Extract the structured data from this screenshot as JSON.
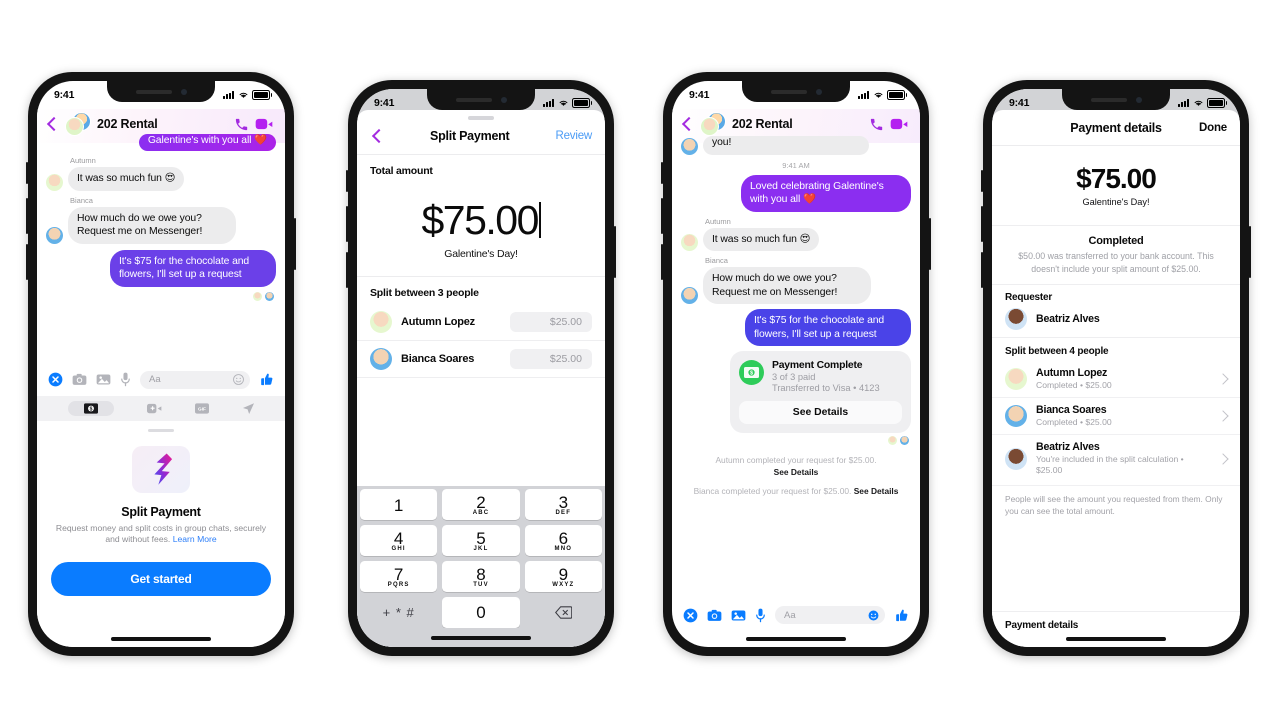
{
  "phones": {
    "p1": {
      "status": {
        "time": "9:41"
      },
      "header": {
        "title": "202 Rental",
        "back_icon": "back-chevron-icon",
        "call_icon": "phone-call-icon",
        "video_icon": "video-camera-icon"
      },
      "messages": [
        {
          "id": "m0",
          "side": "out",
          "text": "Galentine's with you all ❤️",
          "clipped": true
        },
        {
          "id": "m1",
          "side": "in",
          "sender": "Autumn",
          "text": "It was so much fun 😍"
        },
        {
          "id": "m2",
          "side": "in",
          "sender": "Bianca",
          "text": "How much do we owe you? Request me on Messenger!"
        },
        {
          "id": "m3",
          "side": "out",
          "text": "It's $75 for the chocolate and flowers, I'll set up a request"
        }
      ],
      "composer": {
        "placeholder": "Aa",
        "icons": [
          "close-icon",
          "camera-icon",
          "gallery-icon",
          "microphone-icon",
          "emoji-icon",
          "thumbs-up-icon"
        ]
      },
      "tabrow": [
        "payments-icon",
        "video-add-icon",
        "gif-icon",
        "location-icon"
      ],
      "sheet": {
        "icon": "split-payment-dollar-icon",
        "title": "Split Payment",
        "description": "Request money and split costs in group chats, securely and without fees.",
        "link": "Learn More",
        "cta": "Get started"
      }
    },
    "p2": {
      "status": {
        "time": "9:41"
      },
      "nav": {
        "back_icon": "back-chevron-icon",
        "title": "Split Payment",
        "action": "Review"
      },
      "total_label": "Total amount",
      "amount": "$75.00",
      "memo": "Galentine's Day!",
      "split_label": "Split between 3 people",
      "people": [
        {
          "name": "Autumn Lopez",
          "amount": "$25.00"
        },
        {
          "name": "Bianca Soares",
          "amount": "$25.00"
        }
      ],
      "keypad": [
        {
          "d": "1",
          "s": ""
        },
        {
          "d": "2",
          "s": "ABC"
        },
        {
          "d": "3",
          "s": "DEF"
        },
        {
          "d": "4",
          "s": "GHI"
        },
        {
          "d": "5",
          "s": "JKL"
        },
        {
          "d": "6",
          "s": "MNO"
        },
        {
          "d": "7",
          "s": "PQRS"
        },
        {
          "d": "8",
          "s": "TUV"
        },
        {
          "d": "9",
          "s": "WXYZ"
        }
      ],
      "key_symbols": "+ * #",
      "key_zero": "0",
      "key_delete": "backspace-icon"
    },
    "p3": {
      "status": {
        "time": "9:41"
      },
      "header": {
        "title": "202 Rental",
        "back_icon": "back-chevron-icon",
        "call_icon": "phone-call-icon",
        "video_icon": "video-camera-icon"
      },
      "clipped_top": "you!",
      "timestamp": "9:41 AM",
      "messages": [
        {
          "id": "m1",
          "side": "out",
          "text": "Loved celebrating Galentine's with you all ❤️"
        },
        {
          "id": "m2",
          "side": "in",
          "sender": "Autumn",
          "text": "It was so much fun 😍"
        },
        {
          "id": "m3",
          "side": "in",
          "sender": "Bianca",
          "text": "How much do we owe you? Request me on Messenger!"
        },
        {
          "id": "m4",
          "side": "out",
          "text": "It's $75 for the chocolate and flowers, I'll set up a request"
        }
      ],
      "paycard": {
        "badge_icon": "money-bill-icon",
        "title": "Payment Complete",
        "line1": "3 of 3 paid",
        "line2": "Transferred to Visa • 4123",
        "button": "See Details"
      },
      "syslogs": [
        {
          "text": "Autumn completed your request for $25.00.",
          "link": "See Details",
          "break": true
        },
        {
          "text": "Bianca completed your request for $25.00.",
          "link": "See Details",
          "break": false
        }
      ],
      "composer": {
        "placeholder": "Aa",
        "icons": [
          "close-icon",
          "camera-icon",
          "gallery-icon",
          "microphone-icon",
          "emoji-icon",
          "thumbs-up-icon"
        ]
      }
    },
    "p4": {
      "status": {
        "time": "9:41"
      },
      "nav": {
        "title": "Payment details",
        "action": "Done"
      },
      "amount": "$75.00",
      "memo": "Galentine's Day!",
      "completed_title": "Completed",
      "completed_text": "$50.00 was transferred to your bank account. This doesn't include your split amount of $25.00.",
      "requester_label": "Requester",
      "requester_name": "Beatriz Alves",
      "split_label": "Split between 4 people",
      "people": [
        {
          "name": "Autumn Lopez",
          "status": "Completed • $25.00"
        },
        {
          "name": "Bianca Soares",
          "status": "Completed • $25.00"
        },
        {
          "name": "Beatriz Alves",
          "status": "You're included in the split calculation • $25.00"
        }
      ],
      "footer": "People will see the amount you requested from them. Only you can see the total amount.",
      "bottom_label": "Payment details"
    }
  },
  "colors": {
    "messenger_blue": "#0a7cff",
    "bubble_purple": "#6b40e8",
    "bubble_violet": "#8b2ef0",
    "bubble_indigo": "#4a43e8",
    "bubble_grey": "#ececed",
    "link_blue": "#2d7ff9",
    "green": "#2ecc5a",
    "accent_magenta": "#e0218a"
  }
}
